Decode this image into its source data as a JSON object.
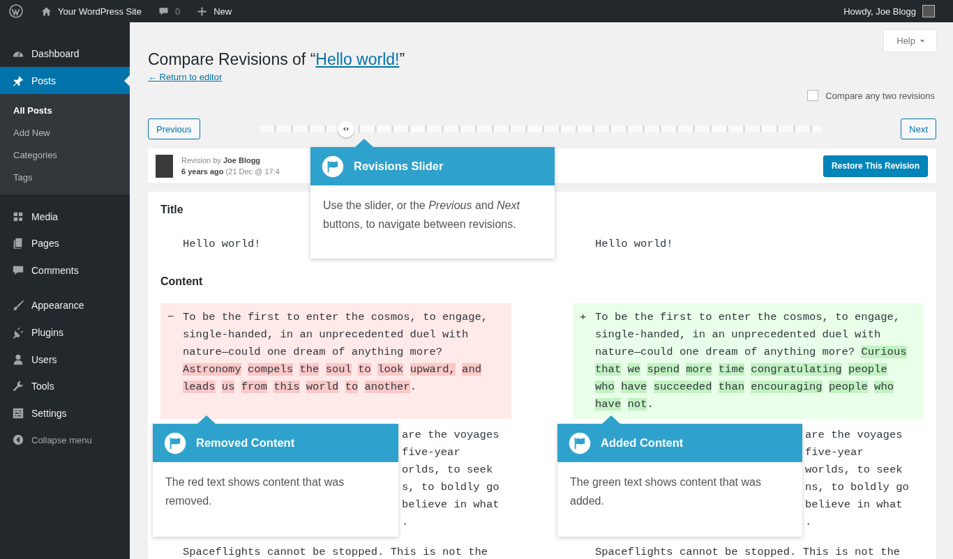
{
  "admin_bar": {
    "site_name": "Your WordPress Site",
    "comments_count": "0",
    "new_label": "New",
    "greeting": "Howdy, Joe Blogg"
  },
  "sidebar": {
    "groups": [
      {
        "items": [
          {
            "label": "Dashboard",
            "selected": false
          },
          {
            "label": "Posts",
            "selected": true,
            "children": [
              {
                "label": "All Posts",
                "selected": true
              },
              {
                "label": "Add New",
                "selected": false
              },
              {
                "label": "Categories",
                "selected": false
              },
              {
                "label": "Tags",
                "selected": false
              }
            ]
          }
        ]
      },
      {
        "items": [
          {
            "label": "Media",
            "selected": false
          },
          {
            "label": "Pages",
            "selected": false
          },
          {
            "label": "Comments",
            "selected": false
          }
        ]
      },
      {
        "items": [
          {
            "label": "Appearance",
            "selected": false
          },
          {
            "label": "Plugins",
            "selected": false
          },
          {
            "label": "Users",
            "selected": false
          },
          {
            "label": "Tools",
            "selected": false
          },
          {
            "label": "Settings",
            "selected": false
          }
        ]
      }
    ],
    "collapse_label": "Collapse menu"
  },
  "help_tab": {
    "label": "Help"
  },
  "page": {
    "title_prefix": "Compare Revisions of “",
    "title_link": "Hello world!",
    "title_suffix": "”",
    "return_link": "← Return to editor"
  },
  "compare_toggle": {
    "label": "Compare any two revisions",
    "checked": false
  },
  "slider": {
    "previous": "Previous",
    "next": "Next",
    "level": 0.155
  },
  "revision": {
    "author_line": "Revision by **Joe Blogg**",
    "date_line": "**6 years ago** (21 Dec @ 17:4",
    "restore": "Restore This Revision"
  },
  "diff": {
    "title_label": "Title",
    "title_left": "Hello world!",
    "title_right": "Hello world!",
    "content_label": "Content",
    "removed": {
      "marker": "−",
      "segments": [
        {
          "text": "To be the first to enter the cosmos, to engage, single-handed, in an unprecedented duel with nature—could one dream of anything more? ",
          "changed": false
        },
        {
          "text": "Astronomy compels the soul to look upward, and leads us from this world to another",
          "changed": true
        },
        {
          "text": ".",
          "changed": false
        }
      ]
    },
    "added": {
      "marker": "+",
      "segments": [
        {
          "text": "To be the first to enter the cosmos, to engage, single-handed, in an unprecedented duel with nature—could one dream of anything more? ",
          "changed": false
        },
        {
          "text": "Curious that we spend more time congratulating people who have succeeded than encouraging people who have not",
          "changed": true
        },
        {
          "text": ".",
          "changed": false
        }
      ]
    },
    "left_partial": [
      "are the voyages",
      "five-year",
      "orlds, to seek",
      "s, to boldly go",
      "believe in what",
      "."
    ],
    "right_partial": [
      "are the voyages",
      "five-year",
      "worlds, to seek",
      "ns, to boldly go",
      "believe in what",
      "."
    ],
    "left_last": "Spaceflights cannot be stopped. This is not the",
    "right_last": "Spaceflights cannot be stopped. This is not the"
  },
  "tooltips": [
    {
      "title": "Revisions Slider",
      "body": "Use the slider, or the *Previous* and *Next* buttons, to navigate between revisions."
    },
    {
      "title": "Removed Content",
      "body": "The red text shows content that was removed."
    },
    {
      "title": "Added Content",
      "body": "The green text shows content that was added."
    }
  ]
}
